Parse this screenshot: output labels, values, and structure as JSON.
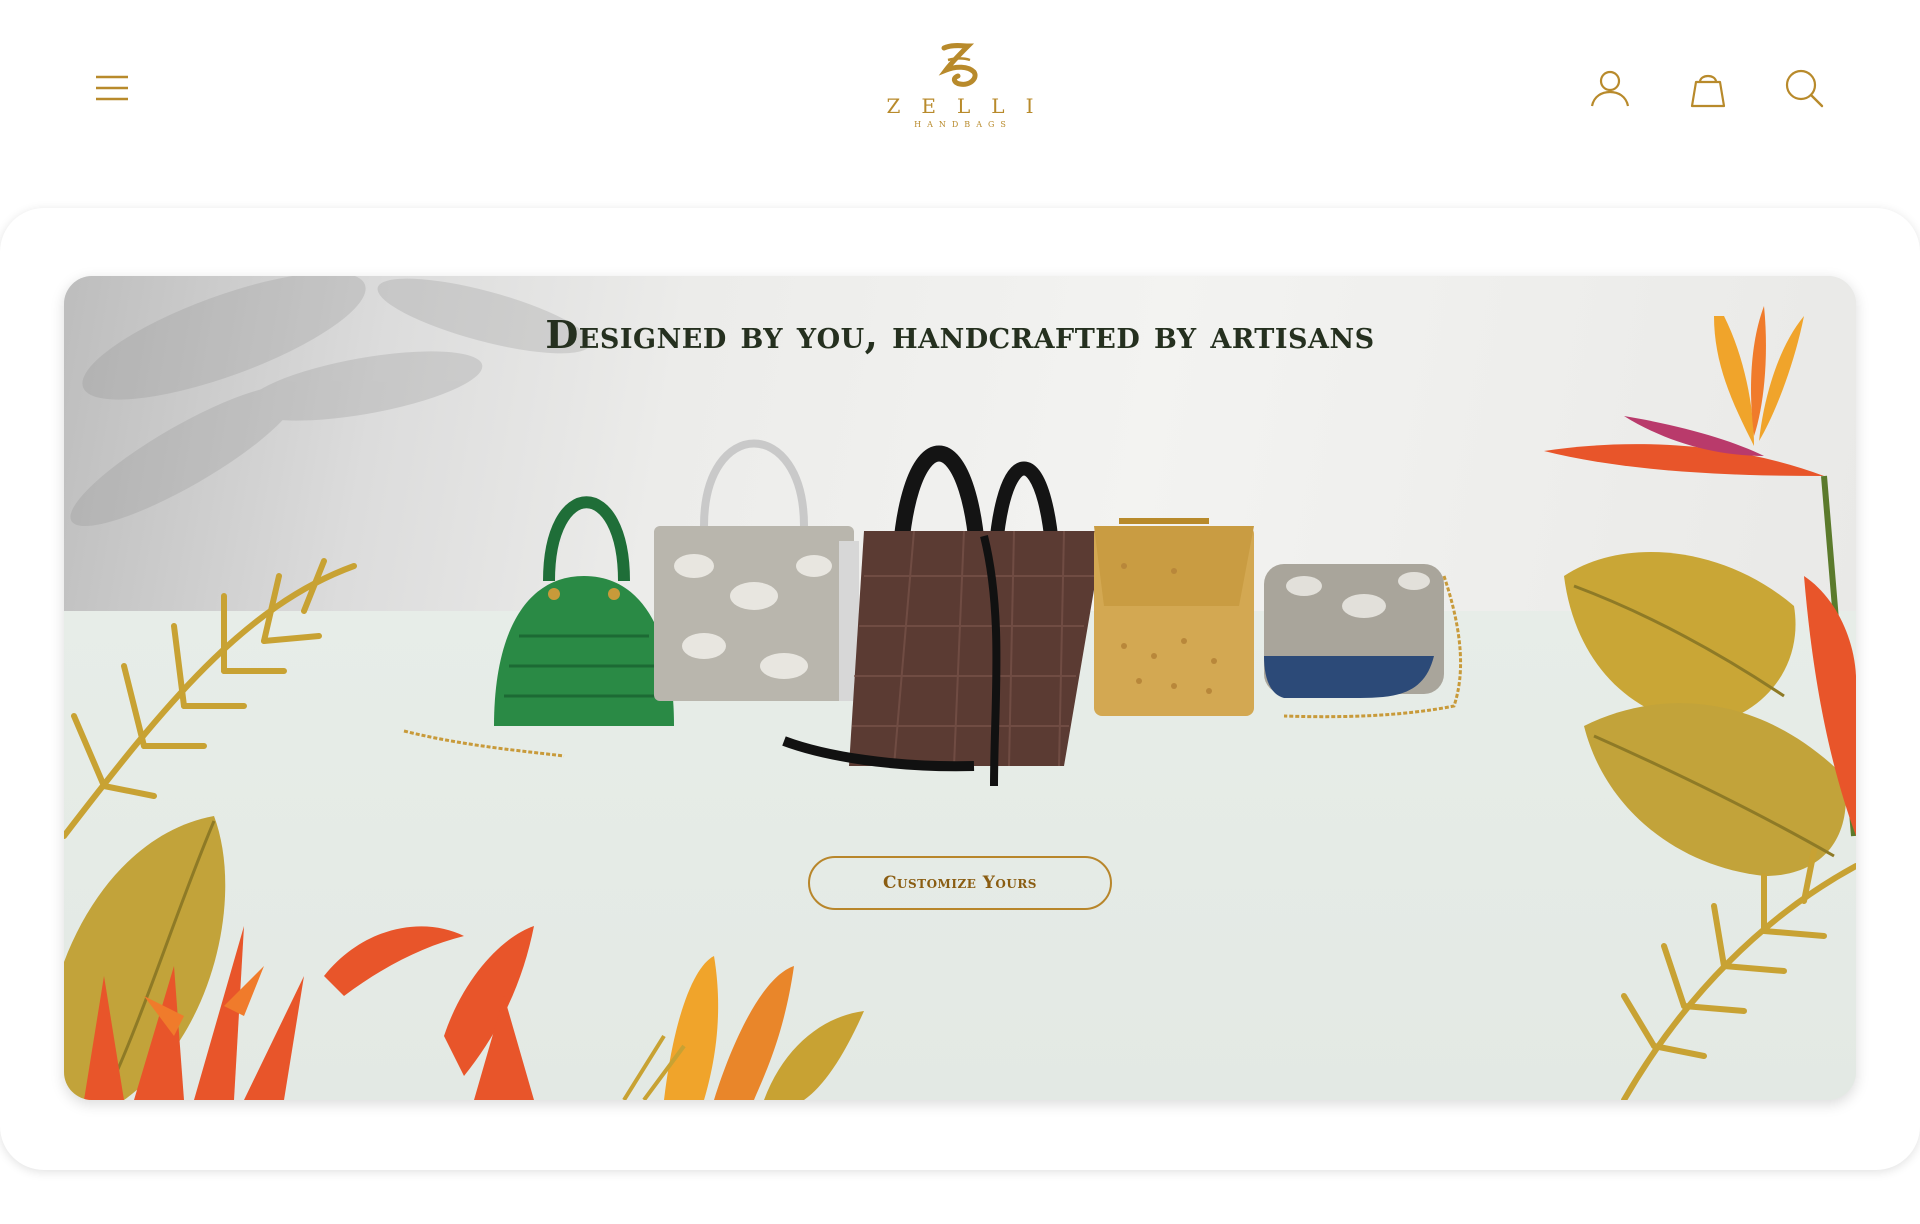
{
  "header": {
    "logo": {
      "word": "ZELLI",
      "sub": "HANDBAGS"
    },
    "icons": [
      "menu-icon",
      "account-icon",
      "bag-icon",
      "search-icon"
    ]
  },
  "hero": {
    "title": "Designed by you, handcrafted by artisans",
    "cta_label": "Customize Yours"
  },
  "colors": {
    "brand_gold": "#b88a2b",
    "title_dark": "#25301f",
    "cta_text": "#8a5d12"
  }
}
